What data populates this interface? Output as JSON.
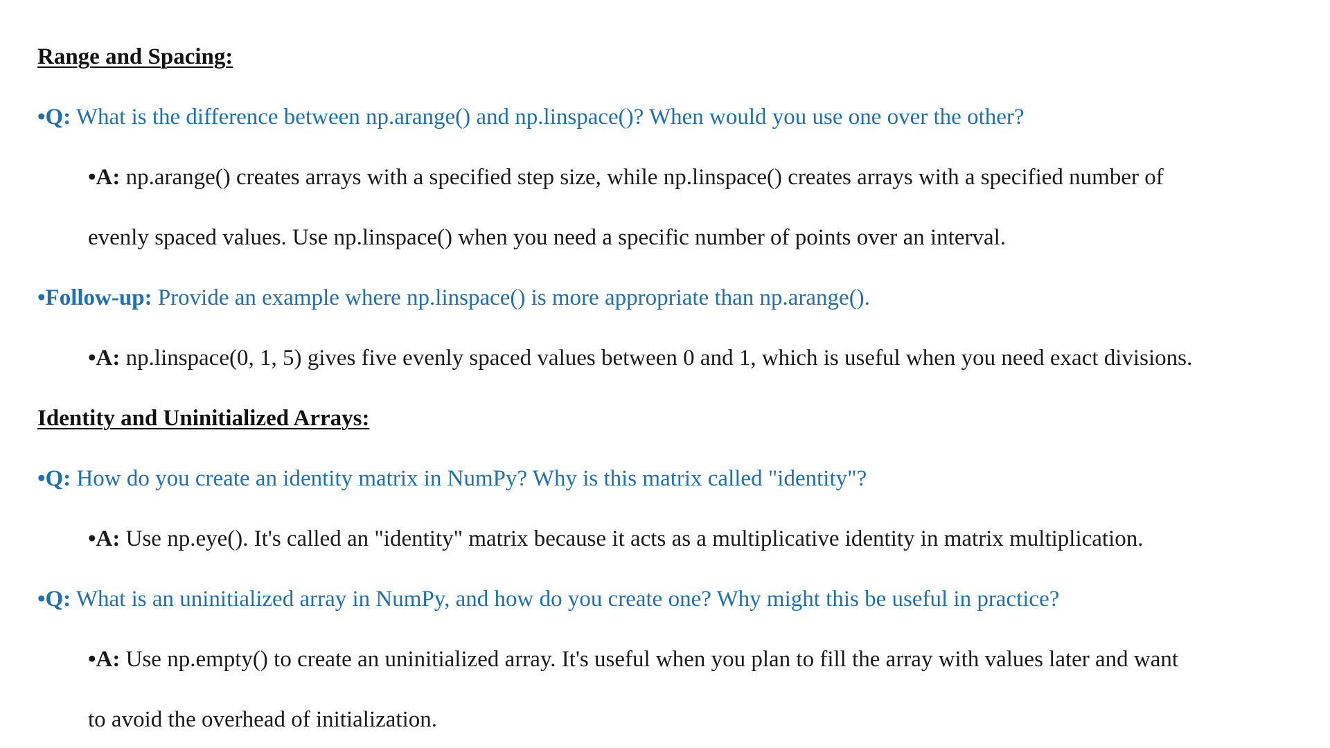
{
  "sections": [
    {
      "heading": "Range and Spacing:",
      "items": [
        {
          "q_label": "•Q:",
          "q_text": "What is the difference between np.arange() and np.linspace()? When would you use one over the other?",
          "a_label": "•A:",
          "a_text": "np.arange() creates arrays with a specified step size, while np.linspace() creates arrays with a specified number of",
          "a_cont": "evenly spaced values. Use np.linspace() when you need a specific number of points over an interval."
        },
        {
          "q_label": "•Follow-up:",
          "q_text": "Provide an example where np.linspace() is more appropriate than np.arange().",
          "a_label": "•A:",
          "a_text": "np.linspace(0, 1, 5) gives five evenly spaced values between 0 and 1, which is useful when you need exact divisions."
        }
      ]
    },
    {
      "heading": "Identity and Uninitialized Arrays:",
      "items": [
        {
          "q_label": "•Q:",
          "q_text": "How do you create an identity matrix in NumPy? Why is this matrix called \"identity\"?",
          "a_label": "•A:",
          "a_text": "Use np.eye(). It's called an \"identity\" matrix because it acts as a multiplicative identity in matrix multiplication."
        },
        {
          "q_label": "•Q:",
          "q_text": "What is an uninitialized array in NumPy, and how do you create one? Why might this be useful in practice?",
          "a_label": "•A:",
          "a_text": "Use np.empty() to create an uninitialized array. It's useful when you plan to fill the array with values later and want",
          "a_cont": "to avoid the overhead of initialization."
        }
      ]
    }
  ],
  "colors": {
    "question": "#1f6fb2",
    "answer": "#1a1a1a",
    "heading": "#111111"
  }
}
